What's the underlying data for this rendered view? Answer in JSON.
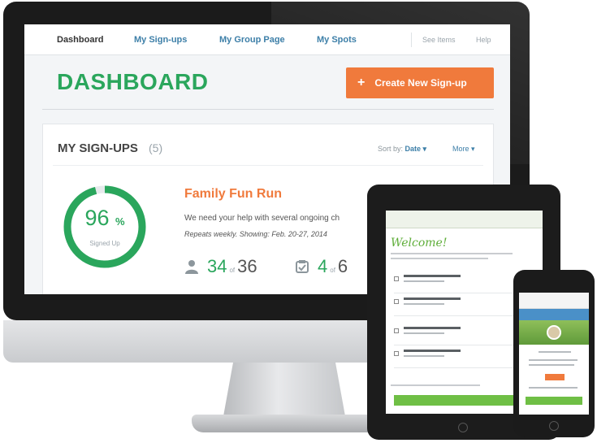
{
  "desktop": {
    "nav": {
      "dashboard": "Dashboard",
      "my_signups": "My Sign-ups",
      "my_group_page": "My Group Page",
      "my_spots": "My Spots",
      "see_items": "See Items",
      "help": "Help"
    },
    "page_title": "DASHBOARD",
    "create_button": {
      "icon": "+",
      "label": "Create New Sign-up"
    },
    "signups_card": {
      "title": "MY SIGN-UPS",
      "count": "(5)",
      "sort_prefix": "Sort by:",
      "sort_value": "Date ▾",
      "more": "More ▾"
    },
    "signup": {
      "percent": "96",
      "percent_sign": "%",
      "percent_fraction": 0.96,
      "progress_label": "Signed Up",
      "title": "Family Fun Run",
      "description": "We need your help with several ongoing ch",
      "repeats": "Repeats weekly. Showing: Feb. 20-27, 2014",
      "people_filled": "34",
      "people_of": "of",
      "people_total": "36",
      "slots_filled": "4",
      "slots_of": "of",
      "slots_total": "6"
    },
    "colors": {
      "green": "#2aa65c",
      "orange": "#f07a3c",
      "blue": "#3d7fa8"
    }
  },
  "tablet": {
    "welcome": "Welcome!"
  }
}
